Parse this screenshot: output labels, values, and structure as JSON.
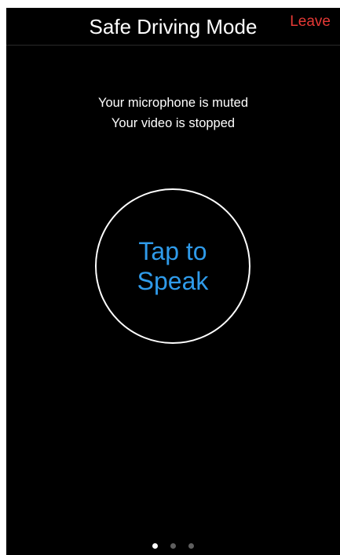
{
  "header": {
    "title": "Safe Driving Mode",
    "leave_label": "Leave"
  },
  "status": {
    "line1": "Your microphone is muted",
    "line2": "Your video is stopped"
  },
  "speak_button": {
    "label": "Tap to\nSpeak"
  },
  "pager": {
    "count": 3,
    "active_index": 0
  },
  "colors": {
    "background": "#000000",
    "leave": "#e53935",
    "accent": "#2f9bea",
    "text": "#ffffff"
  }
}
